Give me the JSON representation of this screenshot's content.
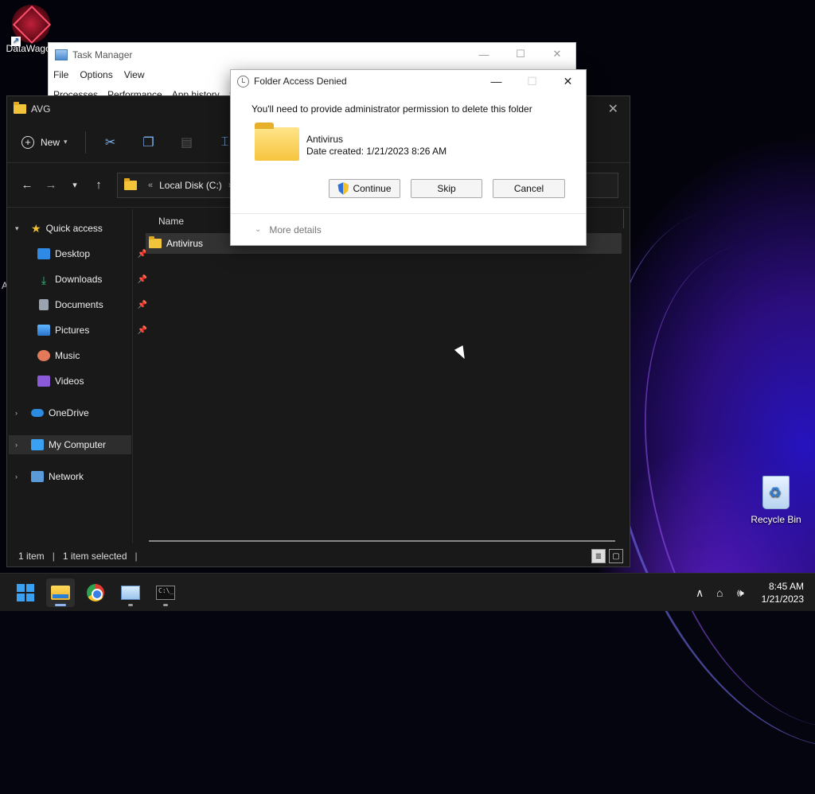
{
  "desktop": {
    "icons": [
      {
        "label": "DataWagon"
      },
      {
        "label": "Recycle Bin"
      }
    ],
    "partial_label": "A"
  },
  "taskmanager": {
    "title": "Task Manager",
    "menu": [
      "File",
      "Options",
      "View"
    ],
    "tabs": [
      "Processes",
      "Performance",
      "App history",
      "S"
    ]
  },
  "explorer": {
    "title": "AVG",
    "toolbar": {
      "new_label": "New"
    },
    "address": {
      "crumb": "Local Disk (C:)"
    },
    "nav": {
      "quick_access": "Quick access",
      "desktop": "Desktop",
      "downloads": "Downloads",
      "documents": "Documents",
      "pictures": "Pictures",
      "music": "Music",
      "videos": "Videos",
      "onedrive": "OneDrive",
      "my_computer": "My Computer",
      "network": "Network"
    },
    "columns": {
      "name": "Name"
    },
    "rows": [
      {
        "name": "Antivirus"
      }
    ],
    "status": {
      "items": "1 item",
      "selected": "1 item selected"
    }
  },
  "dialog": {
    "title": "Folder Access Denied",
    "message": "You'll need to provide administrator permission to delete this folder",
    "folder_name": "Antivirus",
    "date_created": "Date created: 1/21/2023 8:26 AM",
    "buttons": {
      "continue": "Continue",
      "skip": "Skip",
      "cancel": "Cancel"
    },
    "more_details": "More details"
  },
  "taskbar": {
    "apps": [
      "start",
      "file-explorer",
      "chrome",
      "task-manager",
      "command-prompt"
    ],
    "time": "8:45 AM",
    "date": "1/21/2023"
  }
}
